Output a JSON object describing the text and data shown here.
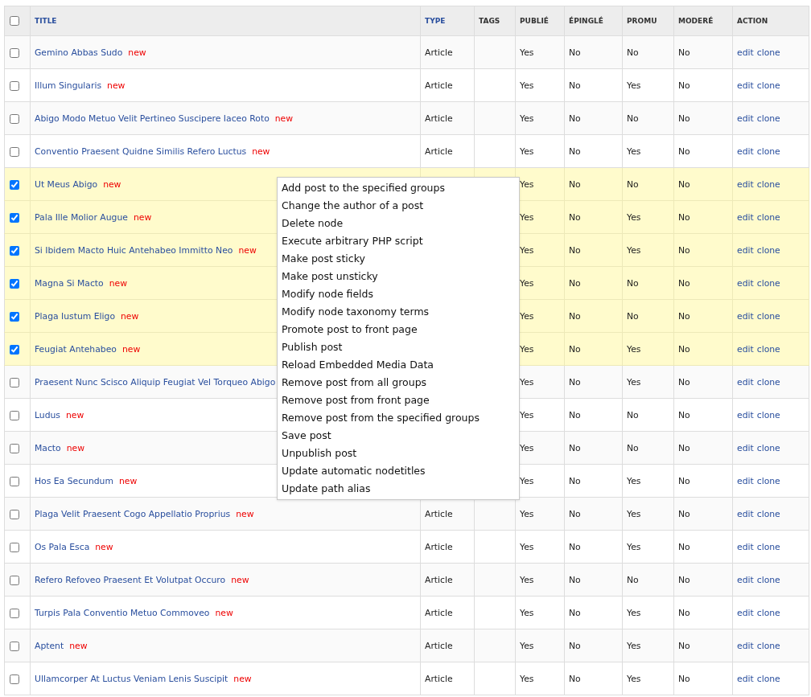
{
  "table": {
    "select_all": {
      "checked": false
    },
    "columns": [
      {
        "label": "TITLE",
        "sortable": true
      },
      {
        "label": "TYPE",
        "sortable": true
      },
      {
        "label": "TAGS",
        "sortable": false
      },
      {
        "label": "PUBLIÉ",
        "sortable": false
      },
      {
        "label": "ÉPINGLÉ",
        "sortable": false
      },
      {
        "label": "PROMU",
        "sortable": false
      },
      {
        "label": "MODERÉ",
        "sortable": false
      },
      {
        "label": "ACTION",
        "sortable": false
      }
    ],
    "rows": [
      {
        "selected": false,
        "title": "Gemino Abbas Sudo",
        "marker": "new",
        "type": "Article",
        "published": "Yes",
        "sticky": "No",
        "promoted": "No",
        "moderated": "No",
        "actions": [
          "edit",
          "clone"
        ]
      },
      {
        "selected": false,
        "title": "Illum Singularis",
        "marker": "new",
        "type": "Article",
        "published": "Yes",
        "sticky": "No",
        "promoted": "Yes",
        "moderated": "No",
        "actions": [
          "edit",
          "clone"
        ]
      },
      {
        "selected": false,
        "title": "Abigo Modo Metuo Velit Pertineo Suscipere Iaceo Roto",
        "marker": "new",
        "type": "Article",
        "published": "Yes",
        "sticky": "No",
        "promoted": "No",
        "moderated": "No",
        "actions": [
          "edit",
          "clone"
        ]
      },
      {
        "selected": false,
        "title": "Conventio Praesent Quidne Similis Refero Luctus",
        "marker": "new",
        "type": "Article",
        "published": "Yes",
        "sticky": "No",
        "promoted": "Yes",
        "moderated": "No",
        "actions": [
          "edit",
          "clone"
        ]
      },
      {
        "selected": true,
        "title": "Ut Meus Abigo",
        "marker": "new",
        "published": "Yes",
        "sticky": "No",
        "promoted": "No",
        "moderated": "No",
        "actions": [
          "edit",
          "clone"
        ]
      },
      {
        "selected": true,
        "title": "Pala Ille Molior Augue",
        "marker": "new",
        "published": "Yes",
        "sticky": "No",
        "promoted": "Yes",
        "moderated": "No",
        "actions": [
          "edit",
          "clone"
        ]
      },
      {
        "selected": true,
        "title": "Si Ibidem Macto Huic Antehabeo Immitto Neo",
        "marker": "new",
        "published": "Yes",
        "sticky": "No",
        "promoted": "Yes",
        "moderated": "No",
        "actions": [
          "edit",
          "clone"
        ]
      },
      {
        "selected": true,
        "title": "Magna Si Macto",
        "marker": "new",
        "published": "Yes",
        "sticky": "No",
        "promoted": "No",
        "moderated": "No",
        "actions": [
          "edit",
          "clone"
        ]
      },
      {
        "selected": true,
        "title": "Plaga Iustum Eligo",
        "marker": "new",
        "published": "Yes",
        "sticky": "No",
        "promoted": "No",
        "moderated": "No",
        "actions": [
          "edit",
          "clone"
        ]
      },
      {
        "selected": true,
        "title": "Feugiat Antehabeo",
        "marker": "new",
        "published": "Yes",
        "sticky": "No",
        "promoted": "Yes",
        "moderated": "No",
        "actions": [
          "edit",
          "clone"
        ]
      },
      {
        "selected": false,
        "title": "Praesent Nunc Scisco Aliquip Feugiat Vel Torqueo Abigo",
        "published": "Yes",
        "sticky": "No",
        "promoted": "Yes",
        "moderated": "No",
        "actions": [
          "edit",
          "clone"
        ]
      },
      {
        "selected": false,
        "title": "Ludus",
        "marker": "new",
        "published": "Yes",
        "sticky": "No",
        "promoted": "No",
        "moderated": "No",
        "actions": [
          "edit",
          "clone"
        ]
      },
      {
        "selected": false,
        "title": "Macto",
        "marker": "new",
        "published": "Yes",
        "sticky": "No",
        "promoted": "No",
        "moderated": "No",
        "actions": [
          "edit",
          "clone"
        ]
      },
      {
        "selected": false,
        "title": "Hos Ea Secundum",
        "marker": "new",
        "published": "Yes",
        "sticky": "No",
        "promoted": "Yes",
        "moderated": "No",
        "actions": [
          "edit",
          "clone"
        ]
      },
      {
        "selected": false,
        "title": "Plaga Velit Praesent Cogo Appellatio Proprius",
        "marker": "new",
        "type": "Article",
        "published": "Yes",
        "sticky": "No",
        "promoted": "Yes",
        "moderated": "No",
        "actions": [
          "edit",
          "clone"
        ]
      },
      {
        "selected": false,
        "title": "Os Pala Esca",
        "marker": "new",
        "type": "Article",
        "published": "Yes",
        "sticky": "No",
        "promoted": "Yes",
        "moderated": "No",
        "actions": [
          "edit",
          "clone"
        ]
      },
      {
        "selected": false,
        "title": "Refero Refoveo Praesent Et Volutpat Occuro",
        "marker": "new",
        "type": "Article",
        "published": "Yes",
        "sticky": "No",
        "promoted": "No",
        "moderated": "No",
        "actions": [
          "edit",
          "clone"
        ]
      },
      {
        "selected": false,
        "title": "Turpis Pala Conventio Metuo Commoveo",
        "marker": "new",
        "type": "Article",
        "published": "Yes",
        "sticky": "No",
        "promoted": "Yes",
        "moderated": "No",
        "actions": [
          "edit",
          "clone"
        ]
      },
      {
        "selected": false,
        "title": "Aptent",
        "marker": "new",
        "type": "Article",
        "published": "Yes",
        "sticky": "No",
        "promoted": "Yes",
        "moderated": "No",
        "actions": [
          "edit",
          "clone"
        ]
      },
      {
        "selected": false,
        "title": "Ullamcorper At Luctus Veniam Lenis Suscipit",
        "marker": "new",
        "type": "Article",
        "published": "Yes",
        "sticky": "No",
        "promoted": "Yes",
        "moderated": "No",
        "actions": [
          "edit",
          "clone"
        ]
      }
    ]
  },
  "operations_menu": {
    "items": [
      "Add post to the specified groups",
      "Change the author of a post",
      "Delete node",
      "Execute arbitrary PHP script",
      "Make post sticky",
      "Make post unsticky",
      "Modify node fields",
      "Modify node taxonomy terms",
      "Promote post to front page",
      "Publish post",
      "Reload Embedded Media Data",
      "Remove post from all groups",
      "Remove post from front page",
      "Remove post from the specified groups",
      "Save post",
      "Unpublish post",
      "Update automatic nodetitles",
      "Update path alias"
    ]
  }
}
